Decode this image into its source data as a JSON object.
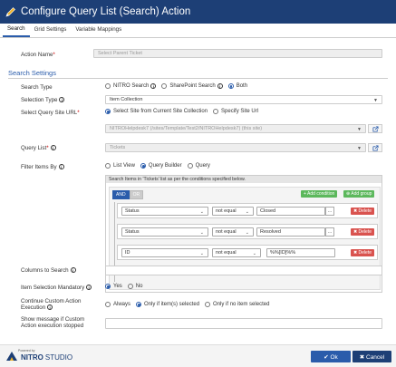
{
  "window": {
    "title": "Configure Query List (Search) Action"
  },
  "tabs": [
    {
      "label": "Search",
      "active": true
    },
    {
      "label": "Grid Settings",
      "active": false
    },
    {
      "label": "Variable Mappings",
      "active": false
    }
  ],
  "action_name": {
    "label": "Action Name",
    "required_mark": "*",
    "placeholder": "Select Parent Ticket"
  },
  "search_settings": {
    "title": "Search Settings",
    "search_type": {
      "label": "Search Type",
      "options": [
        "NITRO Search",
        "SharePoint Search",
        "Both"
      ],
      "selected": "Both"
    },
    "selection_type": {
      "label": "Selection Type",
      "value": "Item Collection"
    },
    "site_url": {
      "label": "Select Query Site URL",
      "required_mark": "*",
      "options": [
        "Select Site from Current Site Collection",
        "Specify Site Url"
      ],
      "selected": "Select Site from Current Site Collection",
      "value": "NITROHelpdesk7 (/sites/Template/Test2/NITROHelpdesk7) (this site)"
    },
    "query_list": {
      "label": "Query List",
      "required_mark": "*",
      "value": "Tickets"
    },
    "filter_items_by": {
      "label": "Filter Items By",
      "options": [
        "List View",
        "Query Builder",
        "Query"
      ],
      "selected": "Query Builder"
    },
    "query_builder": {
      "header": "Search Items in 'Tickets' list as per the conditions specified below.",
      "and_label": "AND",
      "or_label": "OR",
      "add_condition_label": "+ Add condition",
      "add_group_label": "⊕ Add group",
      "delete_label": "✖ Delete",
      "rules": [
        {
          "field": "Status",
          "operator": "not equal",
          "value": "Closed",
          "has_picker": true
        },
        {
          "field": "Status",
          "operator": "not equal",
          "value": "Resolved",
          "has_picker": true
        },
        {
          "field": "ID",
          "operator": "not equal",
          "value": "%%[ID]%%",
          "has_picker": false
        }
      ]
    },
    "columns_to_search": {
      "label": "Columns to Search"
    },
    "item_selection_mandatory": {
      "label": "Item Selection Mandatory",
      "options": [
        "Yes",
        "No"
      ],
      "selected": "Yes"
    },
    "continue_custom_action": {
      "label_line1": "Continue Custom Action",
      "label_line2": "Execution",
      "options": [
        "Always",
        "Only if item(s) selected",
        "Only if no item selected"
      ],
      "selected": "Only if item(s) selected"
    },
    "show_message": {
      "label_line1": "Show message if Custom",
      "label_line2": "Action execution stopped"
    }
  },
  "footer": {
    "powered_by": "Powered by",
    "logo_nitro": "NITRO",
    "logo_studio": "STUDIO",
    "ok_label": "✔ Ok",
    "cancel_label": "✖ Cancel"
  },
  "colors": {
    "header": "#1d3f76",
    "accent": "#2a5cab",
    "delete": "#d9534f",
    "add": "#5cb85c"
  }
}
